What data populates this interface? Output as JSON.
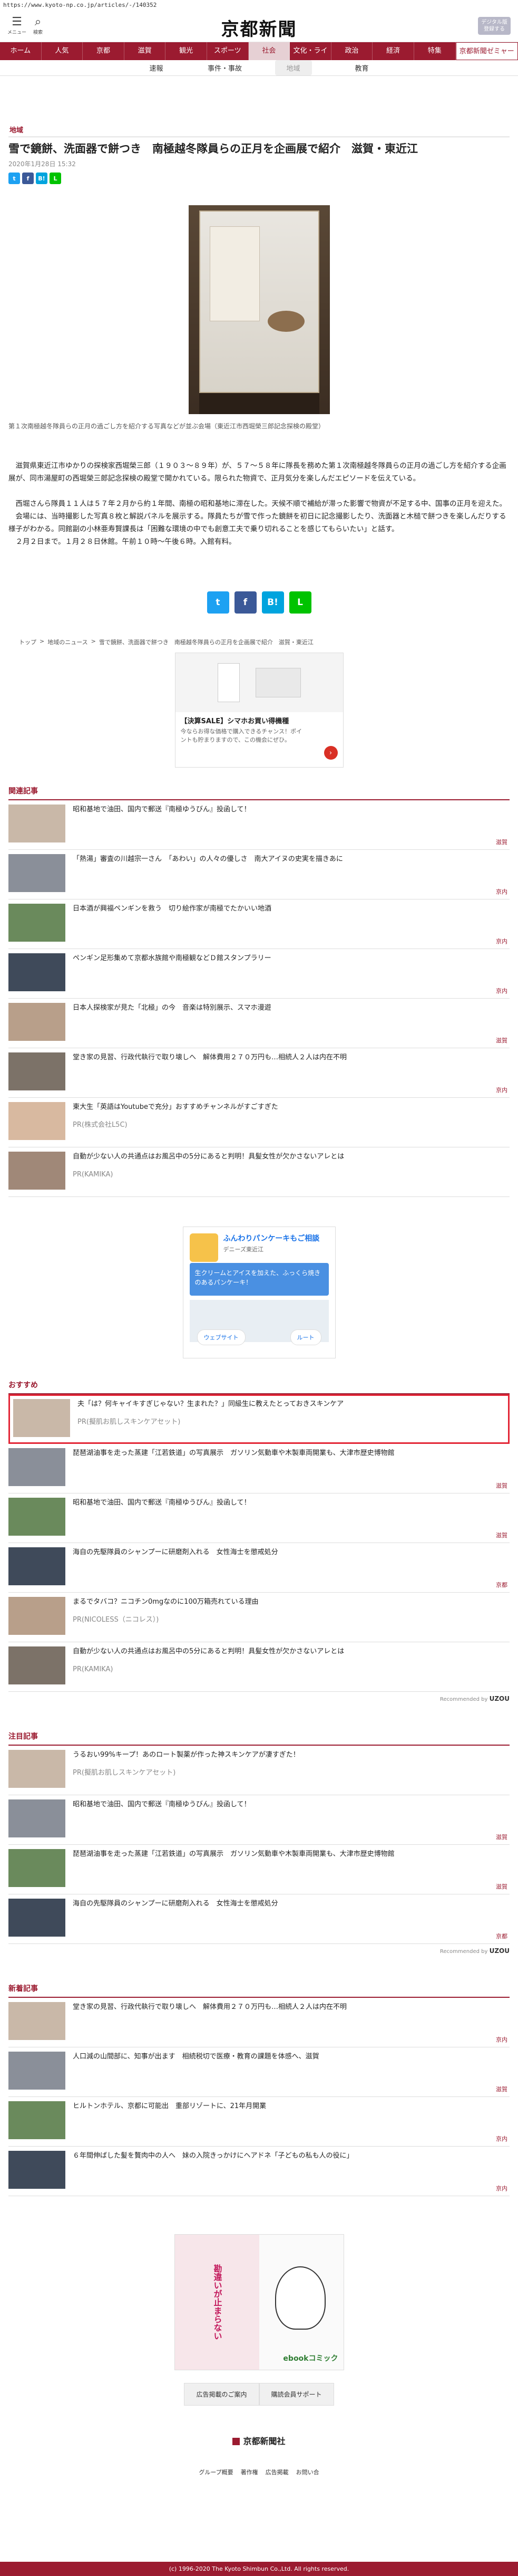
{
  "url": "https://www.kyoto-np.co.jp/articles/-/140352",
  "header": {
    "menu_label": "メニュー",
    "search_label": "検索",
    "logo_text": "京都新聞",
    "digital_button": "デジタル版登録する"
  },
  "gnav": [
    "ホーム",
    "人気",
    "京都",
    "滋賀",
    "観光",
    "スポーツ",
    "社会",
    "文化・ライフ",
    "政治",
    "経済",
    "特集",
    "京都新聞ゼミャー"
  ],
  "gnav_active_index": 6,
  "subnav": [
    "速報",
    "事件・事故",
    "地域",
    "教育"
  ],
  "subnav_active_index": 2,
  "article": {
    "category": "地域",
    "title": "雪で鏡餅、洗面器で餅つき　南極越冬隊員らの正月を企画展で紹介　滋賀・東近江",
    "date": "2020年1月28日 15:32",
    "share_buttons": [
      "t",
      "f",
      "B!",
      "L"
    ],
    "caption": "第１次南極越冬隊員らの正月の過ごし方を紹介する写真などが並ぶ会場（東近江市西堀榮三郎記念探検の殿堂）",
    "paragraphs": [
      "滋賀県東近江市ゆかりの探検家西堀榮三郎（１９０３～８９年）が、５７～５８年に隊長を務めた第１次南極越冬隊員らの正月の過ごし方を紹介する企画展が、同市湯屋町の西堀榮三郎記念探検の殿堂で開かれている。限られた物資で、正月気分を楽しんだエピソードを伝えている。",
      "西堀さんら隊員１１人は５７年２月から約１年間、南極の昭和基地に滞在した。天候不順で補給が滞った影響で物資が不足する中、国事の正月を迎えた。",
      "会場には、当時撮影した写真８枚と解説パネルを展示する。隊員たちが雪で作った鏡餅を初日に記念撮影したり、洗面器と木槌で餅つきを楽しんだりする様子がわかる。同館副の小林亜寿賢課長は「困難な環境の中でも創意工夫で乗り切れることを感じてもらいたい」と話す。",
      "２月２日まで。１月２８日休館。午前１０時～午後６時。入館有料。"
    ]
  },
  "social": [
    "t",
    "f",
    "B!",
    "L"
  ],
  "breadcrumbs": [
    "トップ",
    "地域のニュース",
    "雪で鏡餅、洗面器で餅つき　南極越冬隊員らの正月を企画展で紹介　滋賀・東近江"
  ],
  "ad1": {
    "title": "【決算SALE】シマホお買い得機種",
    "desc": "今ならお得な価格で購入できるチャンス！ポイントも貯まりますので、この機会にぜひ。"
  },
  "related": {
    "heading": "関連記事",
    "items": [
      {
        "text": "昭和基地で油田、国内で郵送『南極ゆうびん』投函して！",
        "tag": "滋賀",
        "pr": false
      },
      {
        "text": "「熱湯」審査の川越宗一さん　「あわい」の人々の優しさ　南大アイヌの史実を描きあに",
        "tag": "京内",
        "pr": false
      },
      {
        "text": "日本酒が興福ペンギンを救う　切り絵作家が南極でたかいい地酒",
        "tag": "京内",
        "pr": false
      },
      {
        "text": "ペンギン足形集めて京都水族館や南極観などＤ館スタンプラリー",
        "tag": "京内",
        "pr": false
      },
      {
        "text": "日本人探検家が見た「北極」の今　音楽は特別展示、スマホ漫遊",
        "tag": "滋賀",
        "pr": false
      },
      {
        "text": "堂き家の見習、行政代執行で取り壊しへ　解体費用２７０万円も…相続人２人は内在不明",
        "tag": "京内",
        "pr": false
      },
      {
        "text": "東大生「英語はYoutubeで充分」おすすめチャンネルがすごすぎた",
        "tag": "",
        "pr": true,
        "sponsor": "PR(株式会社L5C)"
      },
      {
        "text": "自動が少ない人の共通点はお風呂中の5分にあると判明！具髪女性が欠かさないアレとは",
        "tag": "",
        "pr": true,
        "sponsor": "PR(KAMIKA)"
      }
    ]
  },
  "ad2": {
    "title": "ふんわりパンケーキもご相談",
    "sub": "デニーズ東近江",
    "blue": "生クリームとアイスを加えた、ふっくら焼きのあるパンケーキ！",
    "btn1": "ウェブサイト",
    "btn2": "ルート"
  },
  "recommend": {
    "heading": "おすすめ",
    "items": [
      {
        "text": "夫「は？何キャイキすぎじゃない？生まれた？」同級生に教えたとっておきスキンケア",
        "tag": "",
        "pr": true,
        "sponsor": "PR(擬肌お肌しスキンケアセット)",
        "highlight": true
      },
      {
        "text": "琵琶湖油事を走った蒸建「江若鉄道」の写真展示　ガソリン気動車や木製車両開業も、大津市歴史博物館",
        "tag": "滋賀",
        "pr": false
      },
      {
        "text": "昭和基地で油田、国内で郵送『南極ゆうびん』投函して！",
        "tag": "滋賀",
        "pr": false
      },
      {
        "text": "海自の先駆隊員のシャンプーに研磨剤入れる　女性海士を懲戒処分",
        "tag": "京都",
        "pr": false
      },
      {
        "text": "まるでタバコ？ニコチン0mgなのに100万箱売れている理由",
        "tag": "",
        "pr": true,
        "sponsor": "PR(NICOLESS（ニコレス）)"
      },
      {
        "text": "自動が少ない人の共通点はお風呂中の5分にあると判明！具髪女性が欠かさないアレとは",
        "tag": "",
        "pr": true,
        "sponsor": "PR(KAMIKA)"
      }
    ],
    "powered": "Recommended by",
    "brand": "UZOU"
  },
  "attention": {
    "heading": "注目記事",
    "items": [
      {
        "text": "うるおい99%キープ！あのロート製薬が作った神スキンケアが凄すぎた！",
        "tag": "",
        "pr": true,
        "sponsor": "PR(擬肌お肌しスキンケアセット)"
      },
      {
        "text": "昭和基地で油田、国内で郵送『南極ゆうびん』投函して！",
        "tag": "滋賀",
        "pr": false
      },
      {
        "text": "琵琶湖油事を走った蒸建「江若鉄道」の写真展示　ガソリン気動車や木製車両開業も、大津市歴史博物館",
        "tag": "滋賀",
        "pr": false
      },
      {
        "text": "海自の先駆隊員のシャンプーに研磨剤入れる　女性海士を懲戒処分",
        "tag": "京都",
        "pr": false
      }
    ],
    "powered": "Recommended by",
    "brand": "UZOU"
  },
  "newest": {
    "heading": "新着記事",
    "items": [
      {
        "text": "堂き家の見習、行政代執行で取り壊しへ　解体費用２７０万円も…相続人２人は内在不明",
        "tag": "京内"
      },
      {
        "text": "人口減の山間部に、知事が出ます　相続税切で医療・教育の課題を体感へ、滋賀",
        "tag": "滋賀"
      },
      {
        "text": "ヒルトンホテル、京都に可能出　重部リゾートに、21年月開業",
        "tag": "京内"
      },
      {
        "text": "６年間伸ばした髪を贅肉中の人へ　妹の入院きっかけにヘアドネ「子どもの私も人の役に」",
        "tag": "京内"
      }
    ]
  },
  "bigad": {
    "left": "勘違いが止まらない",
    "right_label": "ebookコミック"
  },
  "footer": {
    "links": [
      "広告掲載のご案内",
      "購読会員サポート"
    ],
    "logo": "京都新聞社",
    "nav": [
      "グループ概要",
      "著作権",
      "広告掲載",
      "お問い合"
    ],
    "copyright": "(c) 1996-2020 The Kyoto Shimbun Co.,Ltd. All rights reserved."
  },
  "colors": {
    "brand": "#9b1b30",
    "highlight": "#e32636"
  }
}
